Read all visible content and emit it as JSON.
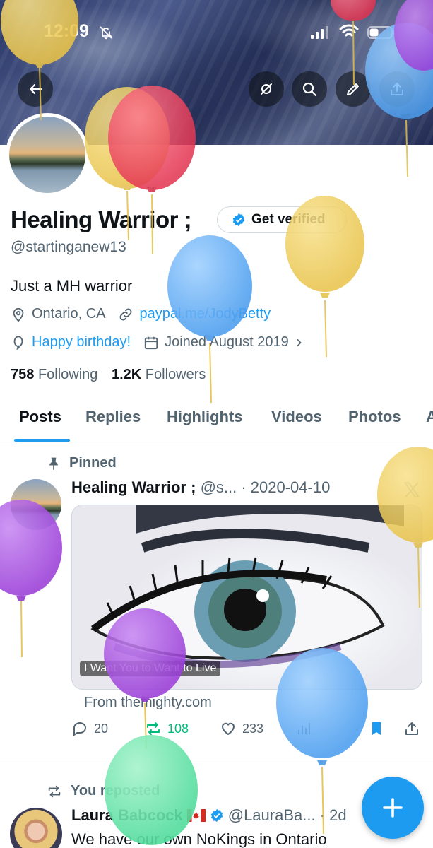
{
  "status": {
    "time": "12:09"
  },
  "profile": {
    "name": "Healing Warrior ;",
    "verify_label": "Get verified",
    "handle": "@startinganew13",
    "bio": "Just a MH warrior",
    "location": "Ontario, CA",
    "link": "paypal.me/JodyBetty",
    "birthday": "Happy birthday!",
    "joined": "Joined August 2019",
    "following_count": "758",
    "following_label": "Following",
    "followers_count": "1.2K",
    "followers_label": "Followers"
  },
  "tabs": [
    "Posts",
    "Replies",
    "Highlights",
    "Videos",
    "Photos",
    "A"
  ],
  "post1": {
    "pinned_label": "Pinned",
    "author": "Healing Warrior ;",
    "meta": "@s... · 2020-04-10",
    "card_title": "I Want You to Want to Live",
    "card_source": "From themighty.com",
    "replies": "20",
    "reposts": "108",
    "likes": "233"
  },
  "post2": {
    "reposted_label": "You reposted",
    "author": "Laura Babcock",
    "meta": "@LauraBa... · 2d",
    "text": "We have our own NoKings in Ontario"
  },
  "colors": {
    "accent": "#1d9bf0",
    "repost_green": "#00ba7c",
    "text": "#0f1419",
    "muted": "#536471"
  },
  "icons": [
    "back-arrow-icon",
    "refresh-icon",
    "search-icon",
    "pencil-icon",
    "share-icon",
    "verified-badge-icon",
    "location-pin-icon",
    "link-icon",
    "balloon-icon",
    "calendar-icon",
    "pin-icon",
    "reply-icon",
    "repost-icon",
    "heart-icon",
    "analytics-icon",
    "bookmark-icon",
    "plus-icon",
    "x-logo-icon"
  ]
}
